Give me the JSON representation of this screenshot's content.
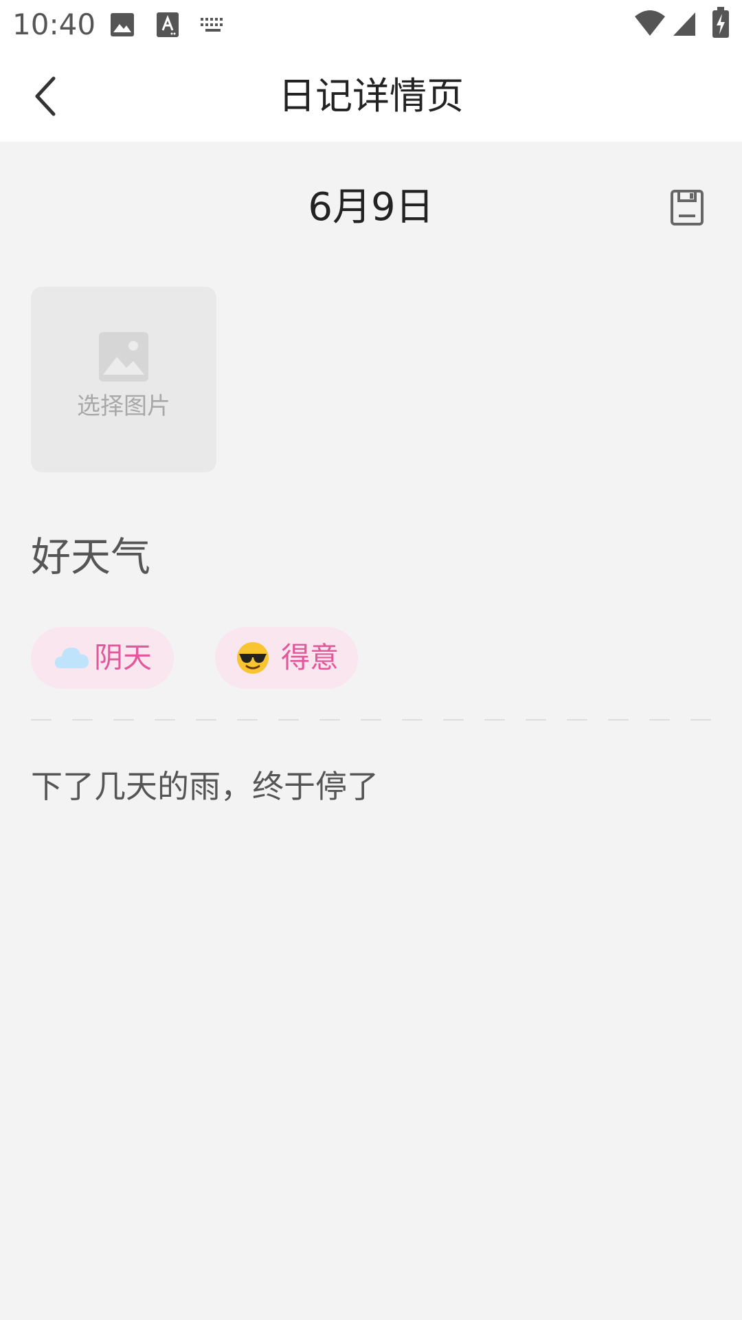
{
  "status_bar": {
    "time": "10:40",
    "icons": [
      "image-icon",
      "text-a-icon",
      "keyboard-icon",
      "wifi-icon",
      "signal-icon",
      "battery-charging-icon"
    ]
  },
  "app_bar": {
    "back_icon": "chevron-left-icon",
    "title": "日记详情页"
  },
  "diary": {
    "date": "6月9日",
    "save_icon": "floppy-save-icon",
    "image_picker": {
      "icon": "image-placeholder-icon",
      "label": "选择图片"
    },
    "title": "好天气",
    "tags": [
      {
        "icon": "cloud-icon",
        "label": "阴天"
      },
      {
        "icon": "sunglasses-face-icon",
        "label": "得意"
      }
    ],
    "body": "下了几天的雨，终于停了"
  },
  "colors": {
    "background": "#f3f3f3",
    "tag_background": "#f9e6ee",
    "tag_text": "#e2589a"
  }
}
